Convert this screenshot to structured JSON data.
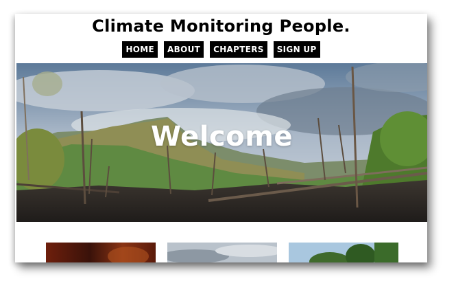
{
  "header": {
    "site_title": "Climate Monitoring People."
  },
  "nav": {
    "items": [
      {
        "label": "HOME"
      },
      {
        "label": "ABOUT"
      },
      {
        "label": "CHAPTERS"
      },
      {
        "label": "SIGN UP"
      }
    ]
  },
  "hero": {
    "heading": "Welcome",
    "image": "burned-hillside-landscape"
  },
  "gallery": {
    "thumbnails": [
      {
        "image": "fire-glow-thumbnail"
      },
      {
        "image": "cloudy-sky-thumbnail"
      },
      {
        "image": "forest-trees-thumbnail"
      }
    ]
  },
  "colors": {
    "nav_background": "#000000",
    "nav_text": "#ffffff",
    "page_background": "#ffffff",
    "title_text": "#000000"
  }
}
